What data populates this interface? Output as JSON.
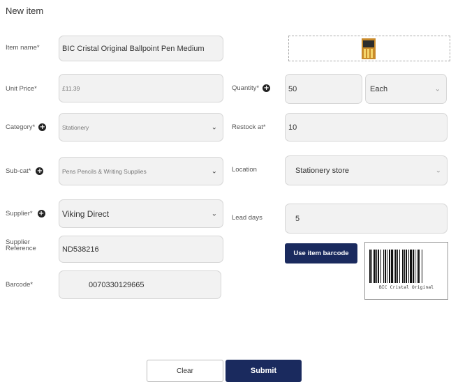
{
  "page": {
    "title": "New item"
  },
  "form": {
    "item_name": {
      "label": "Item name*",
      "value": "BIC Cristal Original Ballpoint Pen Medium"
    },
    "unit_price": {
      "label": "Unit Price*",
      "value": "£11.39"
    },
    "quantity": {
      "label": "Quantity*",
      "value": "50",
      "unit": "Each"
    },
    "category": {
      "label": "Category*",
      "value": "Stationery"
    },
    "restock_at": {
      "label": "Restock at*",
      "value": "10"
    },
    "sub_cat": {
      "label": "Sub-cat*",
      "value": "Pens Pencils & Writing Supplies"
    },
    "location": {
      "label": "Location",
      "value": "Stationery store"
    },
    "supplier": {
      "label": "Supplier*",
      "value": "Viking Direct"
    },
    "lead_days": {
      "label": "Lead days",
      "value": "5"
    },
    "supplier_reference": {
      "label_line1": "Supplier",
      "label_line2": "Reference",
      "value": "ND538216"
    },
    "barcode": {
      "label": "Barcode*",
      "value": "0070330129665"
    }
  },
  "barcode_panel": {
    "button_label": "Use item barcode",
    "caption": "BIC Cristal Original"
  },
  "actions": {
    "clear_label": "Clear",
    "submit_label": "Submit"
  },
  "colors": {
    "primary": "#1a2a5e",
    "field_bg": "#f2f2f2",
    "border": "#d6d6d6"
  },
  "icons": {
    "add": "plus-circle-icon",
    "dropdown": "chevron-down-icon",
    "product": "product-image"
  }
}
